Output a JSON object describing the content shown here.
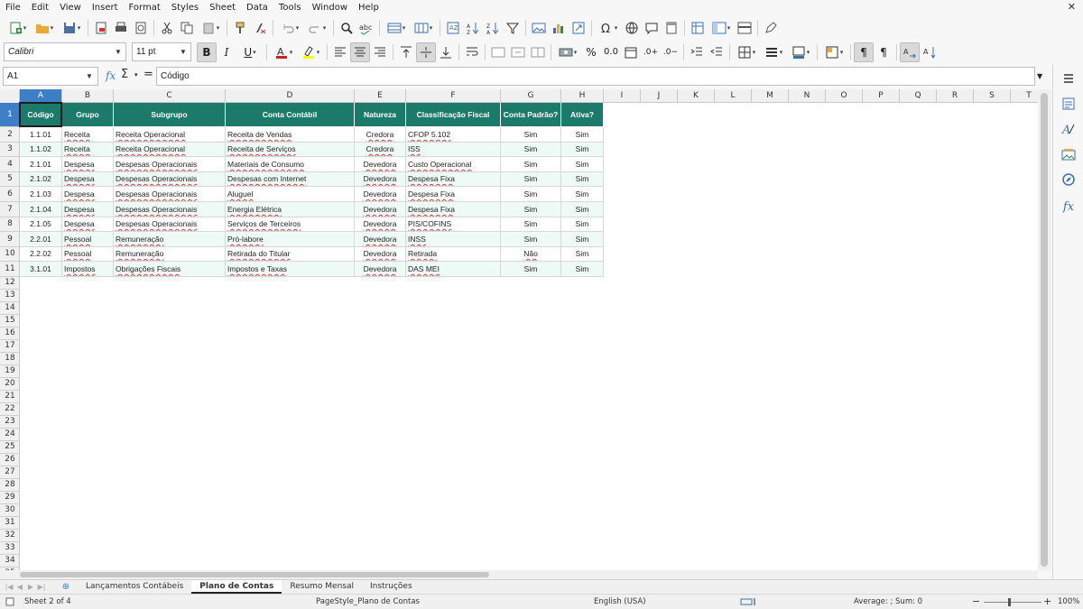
{
  "menu": [
    "File",
    "Edit",
    "View",
    "Insert",
    "Format",
    "Styles",
    "Sheet",
    "Data",
    "Tools",
    "Window",
    "Help"
  ],
  "toolbar2": {
    "font_name": "Calibri",
    "font_size": "11 pt"
  },
  "formula_bar": {
    "cell_ref": "A1",
    "content": "Código"
  },
  "colors": {
    "header_fill": "#1b7a6a",
    "header_text": "#ffffff",
    "band_fill": "#eefaf6",
    "selection": "#3d7fc6"
  },
  "columns": [
    "A",
    "B",
    "C",
    "D",
    "E",
    "F",
    "G",
    "H",
    "I",
    "J",
    "K",
    "L",
    "M",
    "N",
    "O",
    "P",
    "Q",
    "R",
    "S",
    "T"
  ],
  "rows": [
    "1",
    "2",
    "3",
    "4",
    "5",
    "6",
    "7",
    "8",
    "9",
    "10",
    "11",
    "12",
    "13",
    "14",
    "15",
    "16",
    "17",
    "18",
    "19",
    "20",
    "21",
    "22",
    "23",
    "24",
    "25",
    "26",
    "27",
    "28",
    "29",
    "30",
    "31",
    "32",
    "33",
    "34",
    "35"
  ],
  "table": {
    "headers": [
      "Código",
      "Grupo",
      "Subgrupo",
      "Conta Contábil",
      "Natureza",
      "Classificação Fiscal",
      "Conta Padrão?",
      "Ativa?"
    ],
    "rows": [
      [
        "1.1.01",
        "Receita",
        "Receita Operacional",
        "Receita de Vendas",
        "Credora",
        "CFOP 5.102",
        "Sim",
        "Sim"
      ],
      [
        "1.1.02",
        "Receita",
        "Receita Operacional",
        "Receita de Serviços",
        "Credora",
        "ISS",
        "Sim",
        "Sim"
      ],
      [
        "2.1.01",
        "Despesa",
        "Despesas Operacionais",
        "Materiais de Consumo",
        "Devedora",
        "Custo Operacional",
        "Sim",
        "Sim"
      ],
      [
        "2.1.02",
        "Despesa",
        "Despesas Operacionais",
        "Despesas com Internet",
        "Devedora",
        "Despesa Fixa",
        "Sim",
        "Sim"
      ],
      [
        "2.1.03",
        "Despesa",
        "Despesas Operacionais",
        "Aluguel",
        "Devedora",
        "Despesa Fixa",
        "Sim",
        "Sim"
      ],
      [
        "2.1.04",
        "Despesa",
        "Despesas Operacionais",
        "Energia Elétrica",
        "Devedora",
        "Despesa Fixa",
        "Sim",
        "Sim"
      ],
      [
        "2.1.05",
        "Despesa",
        "Despesas Operacionais",
        "Serviços de Terceiros",
        "Devedora",
        "PIS/COFINS",
        "Sim",
        "Sim"
      ],
      [
        "2.2.01",
        "Pessoal",
        "Remuneração",
        "Pró-labore",
        "Devedora",
        "INSS",
        "Sim",
        "Sim"
      ],
      [
        "2.2.02",
        "Pessoal",
        "Remuneração",
        "Retirada do Titular",
        "Devedora",
        "Retirada",
        "Não",
        "Sim"
      ],
      [
        "3.1.01",
        "Impostos",
        "Obrigações Fiscais",
        "Impostos e Taxas",
        "Devedora",
        "DAS MEI",
        "Sim",
        "Sim"
      ]
    ]
  },
  "sheets": [
    "Lançamentos Contábeis",
    "Plano de Contas",
    "Resumo Mensal",
    "Instruções"
  ],
  "active_sheet": "Plano de Contas",
  "status": {
    "sheet": "Sheet 2 of 4",
    "page_style": "PageStyle_Plano de Contas",
    "language": "English (USA)",
    "summary": "Average: ; Sum: 0",
    "zoom": "100%",
    "zoom_minus": "−",
    "zoom_plus": "+"
  },
  "icons": {
    "close": "close-icon",
    "add_sheet": "add-sheet-icon"
  }
}
